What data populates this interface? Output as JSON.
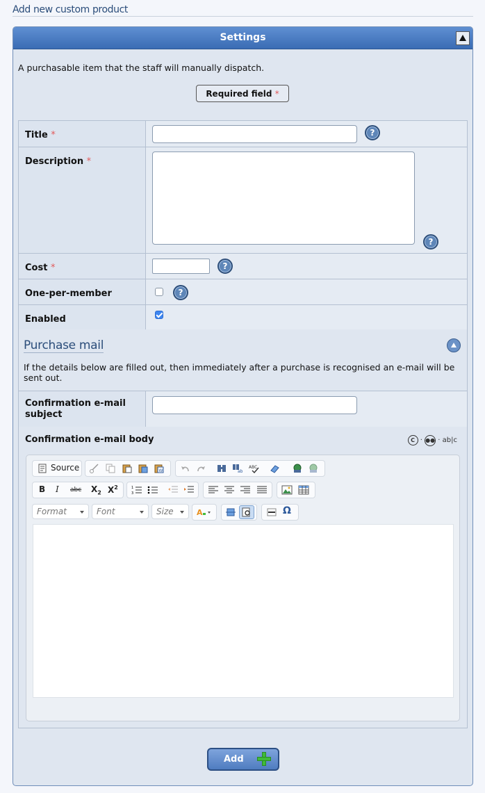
{
  "page": {
    "title": "Add new custom product"
  },
  "panel": {
    "header": "Settings",
    "intro": "A purchasable item that the staff will manually dispatch.",
    "required_note": "Required field",
    "required_marker": "*"
  },
  "fields": {
    "title": {
      "label": "Title",
      "required": true,
      "value": ""
    },
    "description": {
      "label": "Description",
      "required": true,
      "value": ""
    },
    "cost": {
      "label": "Cost",
      "required": true,
      "value": ""
    },
    "one_per_member": {
      "label": "One-per-member",
      "checked": false
    },
    "enabled": {
      "label": "Enabled",
      "checked": true
    }
  },
  "purchase_mail": {
    "title": "Purchase mail",
    "description": "If the details below are filled out, then immediately after a purchase is recognised an e-mail will be sent out.",
    "subject": {
      "label": "Confirmation e-mail subject",
      "value": ""
    },
    "body": {
      "label": "Confirmation e-mail body",
      "icons": [
        "comcode-icon",
        "emoticon-icon",
        "spellcheck-icon"
      ],
      "icon_text": "ab|c"
    }
  },
  "editor": {
    "source_label": "Source",
    "format_placeholder": "Format",
    "font_placeholder": "Font",
    "size_placeholder": "Size",
    "toolbar_icons": [
      "source-icon",
      "cut-icon",
      "copy-icon",
      "paste-icon",
      "paste-text-icon",
      "paste-word-icon",
      "undo-icon",
      "redo-icon",
      "find-icon",
      "replace-icon",
      "spellcheck-icon",
      "remove-format-icon",
      "link-icon",
      "unlink-icon",
      "bold-icon",
      "italic-icon",
      "strike-icon",
      "subscript-icon",
      "superscript-icon",
      "numbered-list-icon",
      "bulleted-list-icon",
      "outdent-icon",
      "indent-icon",
      "align-left-icon",
      "align-center-icon",
      "align-right-icon",
      "justify-icon",
      "image-icon",
      "table-icon",
      "text-color-icon",
      "show-blocks-icon",
      "preview-icon",
      "horizontal-rule-icon",
      "special-char-icon"
    ]
  },
  "actions": {
    "submit": "Add"
  },
  "colors": {
    "accent": "#3a6cb4",
    "required": "#e25a5a",
    "add_green": "#3fbb39"
  }
}
